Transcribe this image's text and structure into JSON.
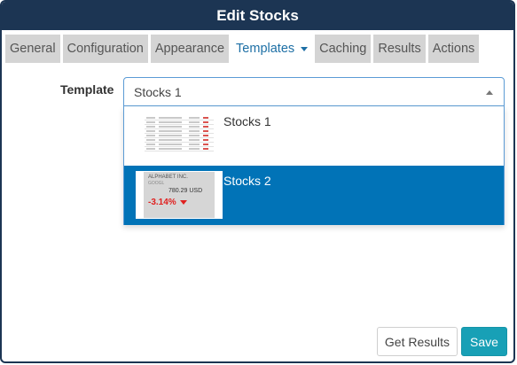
{
  "dialog": {
    "title": "Edit Stocks"
  },
  "tabs": [
    {
      "label": "General",
      "active": false
    },
    {
      "label": "Configuration",
      "active": false
    },
    {
      "label": "Appearance",
      "active": false
    },
    {
      "label": "Templates",
      "active": true
    },
    {
      "label": "Caching",
      "active": false
    },
    {
      "label": "Results",
      "active": false
    },
    {
      "label": "Actions",
      "active": false
    }
  ],
  "template_field": {
    "label": "Template",
    "value": "Stocks 1",
    "options": [
      {
        "label": "Stocks 1",
        "highlighted": false
      },
      {
        "label": "Stocks 2",
        "highlighted": true
      }
    ]
  },
  "thumb2": {
    "company": "ALPHABET INC.",
    "symbol": "GOOGL",
    "price": "780.29 USD",
    "change": "-3.14%"
  },
  "buttons": {
    "get_results": "Get Results",
    "save": "Save"
  },
  "colors": {
    "titlebar": "#1c3553",
    "accent": "#0173b7",
    "save": "#18a0b6",
    "negative": "#e0201f"
  }
}
